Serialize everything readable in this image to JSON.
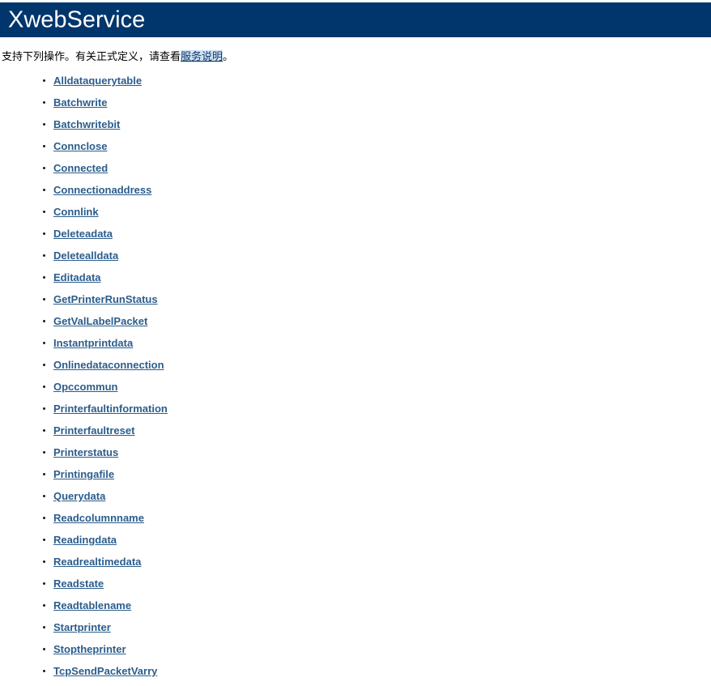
{
  "header": {
    "title": "XwebService",
    "background_color": "#00366c",
    "text_color": "#ffffff"
  },
  "intro": {
    "text_before_link": "支持下列操作。有关正式定义，请查看",
    "link_label": "服务说明",
    "text_after_link": "。",
    "link_color": "#13386e",
    "link_highlight_color": "#cfe2f3"
  },
  "operations": {
    "link_color": "#2b5d8c",
    "items": [
      {
        "label": "Alldataquerytable"
      },
      {
        "label": "Batchwrite"
      },
      {
        "label": "Batchwritebit"
      },
      {
        "label": "Connclose"
      },
      {
        "label": "Connected"
      },
      {
        "label": "Connectionaddress"
      },
      {
        "label": "Connlink"
      },
      {
        "label": "Deleteadata"
      },
      {
        "label": "Deletealldata"
      },
      {
        "label": "Editadata"
      },
      {
        "label": "GetPrinterRunStatus"
      },
      {
        "label": "GetValLabelPacket"
      },
      {
        "label": "Instantprintdata"
      },
      {
        "label": "Onlinedataconnection"
      },
      {
        "label": "Opccommun"
      },
      {
        "label": "Printerfaultinformation"
      },
      {
        "label": "Printerfaultreset"
      },
      {
        "label": "Printerstatus"
      },
      {
        "label": "Printingafile"
      },
      {
        "label": "Querydata"
      },
      {
        "label": "Readcolumnname"
      },
      {
        "label": "Readingdata"
      },
      {
        "label": "Readrealtimedata"
      },
      {
        "label": "Readstate"
      },
      {
        "label": "Readtablename"
      },
      {
        "label": "Startprinter"
      },
      {
        "label": "Stoptheprinter"
      },
      {
        "label": "TcpSendPacketVarry"
      }
    ]
  }
}
